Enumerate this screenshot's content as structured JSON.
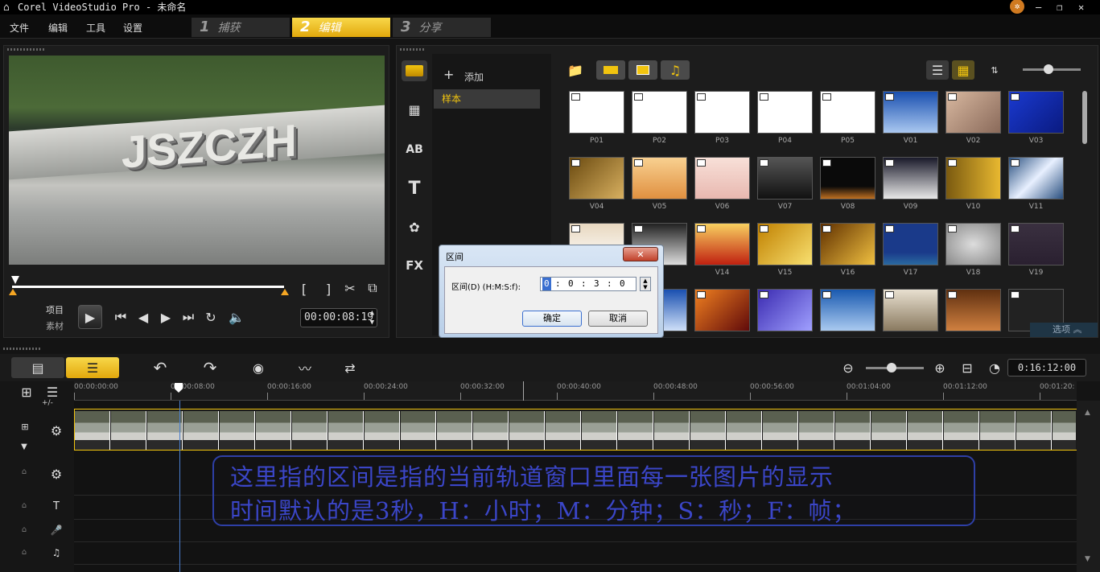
{
  "window": {
    "title": "Corel VideoStudio Pro - 未命名"
  },
  "menu": [
    "文件",
    "编辑",
    "工具",
    "设置"
  ],
  "steps": [
    {
      "num": "1",
      "label": "捕获"
    },
    {
      "num": "2",
      "label": "编辑"
    },
    {
      "num": "3",
      "label": "分享"
    }
  ],
  "preview": {
    "watermark": "JSZCZH",
    "project_label": "项目",
    "clip_label": "素材",
    "timecode": "00:00:08:19"
  },
  "library": {
    "add_label": "添加",
    "folder": "样本",
    "options_label": "选项",
    "thumbs": [
      [
        "P01",
        "P02",
        "P03",
        "P04",
        "P05",
        "V01",
        "V02",
        "V03"
      ],
      [
        "V04",
        "V05",
        "V06",
        "V07",
        "V08",
        "V09",
        "V10",
        "V11"
      ],
      [
        "",
        "",
        "V14",
        "V15",
        "V16",
        "V17",
        "V18",
        "V19"
      ],
      [
        "",
        "",
        "",
        "",
        "",
        "",
        "",
        ""
      ]
    ]
  },
  "dialog": {
    "title": "区间",
    "field_label": "区间(D)  (H:M:S:f):",
    "h": "0",
    "m": "0",
    "s": "3",
    "f": "0",
    "ok": "确定",
    "cancel": "取消"
  },
  "timeline": {
    "duration": "0:16:12:00",
    "ruler": [
      "00:00:00:00",
      "00:00:08:00",
      "00:00:16:00",
      "00:00:24:00",
      "00:00:32:00",
      "00:00:40:00",
      "00:00:48:00",
      "00:00:56:00",
      "00:01:04:00",
      "00:01:12:00",
      "00:01:20:"
    ],
    "add_remove": "+/-"
  },
  "annotation": {
    "line1": "这里指的区间是指的当前轨道窗口里面每一张图片的显示",
    "line2": "时间默认的是3秒，H：小时；M：分钟；S：秒；F：帧；"
  },
  "colors": {
    "accent": "#f1c40f",
    "dialog_border": "#2e3fa6",
    "annotation_text": "#3b46c8"
  }
}
